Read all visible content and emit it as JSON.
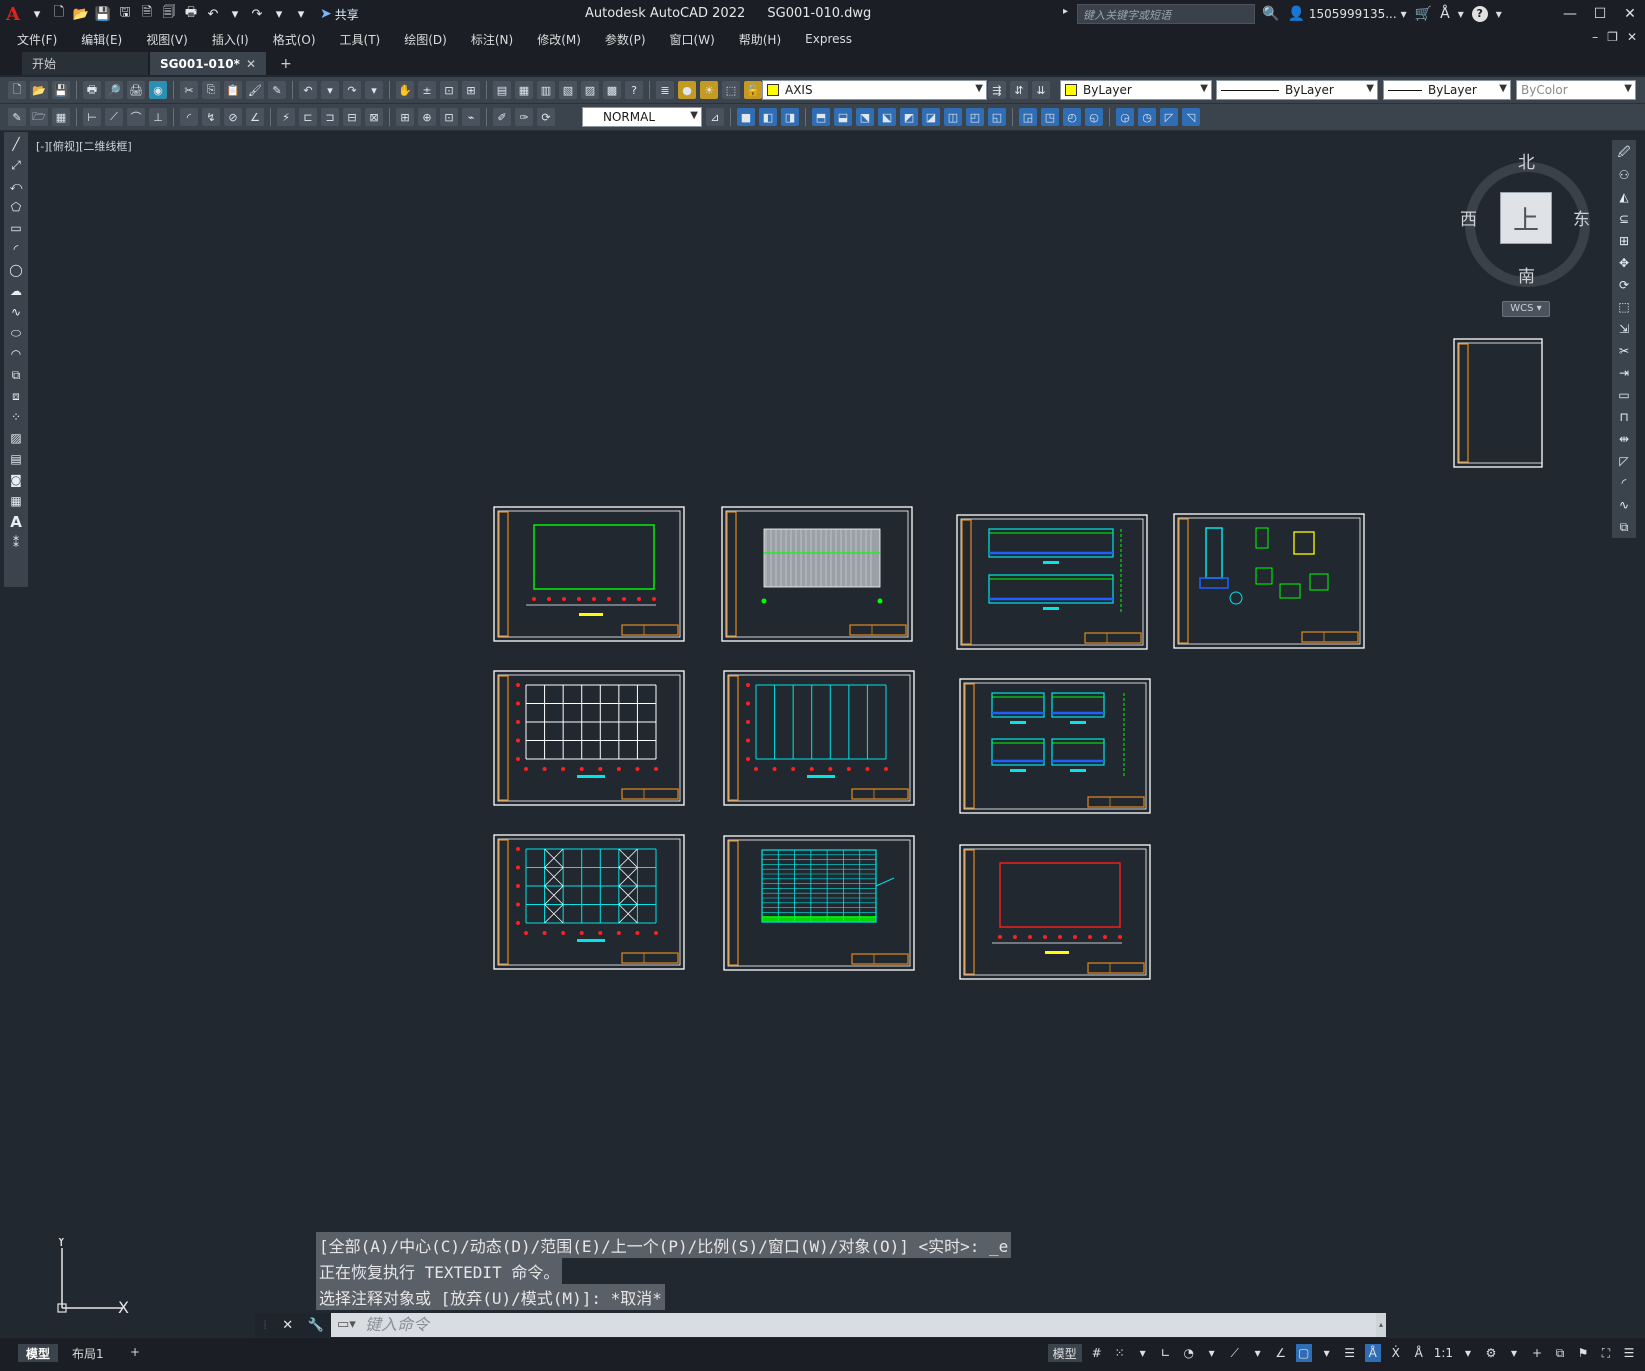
{
  "app": {
    "logo": "A",
    "share_label": "共享",
    "title": "Autodesk AutoCAD 2022",
    "filename": "SG001-010.dwg",
    "search_placeholder": "键入关键字或短语",
    "user": "1505999135...",
    "help": "?"
  },
  "menu": [
    "文件(F)",
    "编辑(E)",
    "视图(V)",
    "插入(I)",
    "格式(O)",
    "工具(T)",
    "绘图(D)",
    "标注(N)",
    "修改(M)",
    "参数(P)",
    "窗口(W)",
    "帮助(H)",
    "Express"
  ],
  "tabs": {
    "start": "开始",
    "active": "SG001-010*",
    "close": "✕",
    "add": "+"
  },
  "toolbar": {
    "layer": "AXIS",
    "color": "ByLayer",
    "linetype": "ByLayer",
    "lineweight": "ByLayer",
    "plotstyle": "ByColor",
    "dimstyle": "NORMAL",
    "layer_color": "#ffff00"
  },
  "viewport": {
    "label": "[-][俯视][二维线框]"
  },
  "viewcube": {
    "north": "北",
    "south": "南",
    "east": "东",
    "west": "西",
    "face": "上",
    "wcs": "WCS"
  },
  "command": {
    "history": [
      "[全部(A)/中心(C)/动态(D)/范围(E)/上一个(P)/比例(S)/窗口(W)/对象(O)] <实时>: _e",
      "正在恢复执行 TEXTEDIT 命令。",
      "选择注释对象或 [放弃(U)/模式(M)]: *取消*"
    ],
    "placeholder": "键入命令"
  },
  "ucs": {
    "x": "X",
    "y": "Y"
  },
  "status": {
    "model_tab": "模型",
    "layout_tab": "布局1",
    "add_tab": "+",
    "model_btn": "模型",
    "scale": "1:1"
  },
  "colors": {
    "canvas": "#212830",
    "sheet_border": "#ffffff",
    "title_block": "#e08a1e",
    "green": "#00ff00",
    "cyan": "#00e5e5",
    "red": "#ff2020",
    "blue": "#2060ff",
    "yellow": "#ffff00"
  }
}
